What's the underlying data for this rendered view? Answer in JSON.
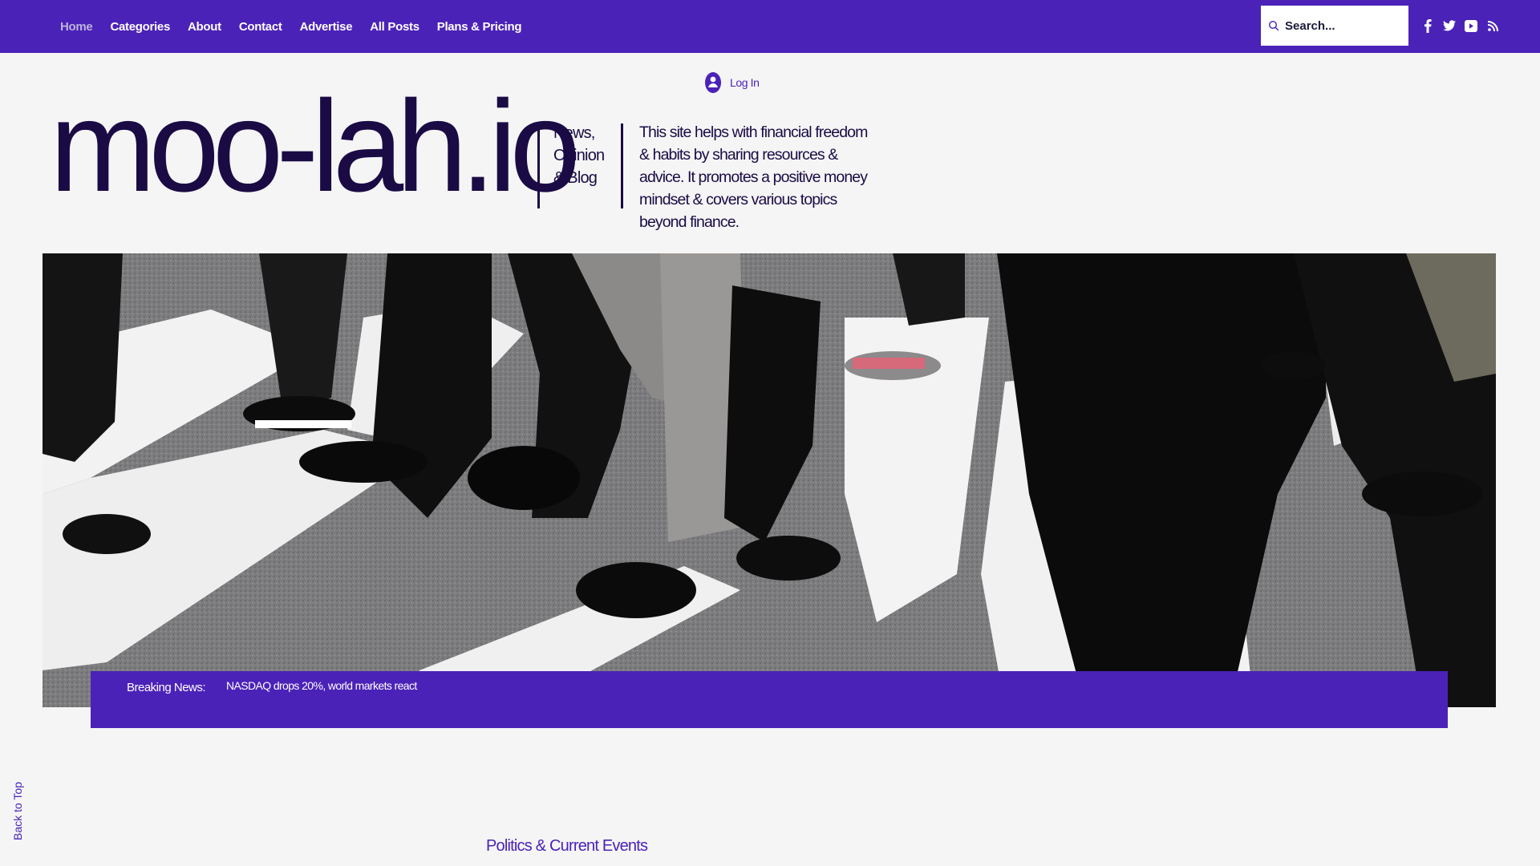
{
  "nav": {
    "items": [
      {
        "label": "Home",
        "active": true
      },
      {
        "label": "Categories",
        "active": false
      },
      {
        "label": "About",
        "active": false
      },
      {
        "label": "Contact",
        "active": false
      },
      {
        "label": "Advertise",
        "active": false
      },
      {
        "label": "All Posts",
        "active": false
      },
      {
        "label": "Plans & Pricing",
        "active": false
      }
    ]
  },
  "search": {
    "placeholder": "Search...",
    "icon": "search-icon"
  },
  "social": [
    {
      "name": "facebook-icon"
    },
    {
      "name": "twitter-icon"
    },
    {
      "name": "youtube-icon"
    },
    {
      "name": "rss-icon"
    }
  ],
  "header": {
    "login_label": "Log In",
    "logo_text": "moo-lah.io",
    "tagline": "News, Opinion & Blog",
    "description": "This site helps with financial freedom & habits by sharing resources & advice. It promotes a positive money mindset & covers various topics beyond finance."
  },
  "breaking": {
    "label": "Breaking News:",
    "headline": "NASDAQ drops 20%, world markets react"
  },
  "back_to_top": "Back to Top",
  "section": {
    "title": "Politics & Current Events"
  },
  "colors": {
    "brand": "#4b22b8",
    "logo": "#1a0b45",
    "background": "#f5f5f5",
    "nav_active": "#bdb4dc"
  }
}
